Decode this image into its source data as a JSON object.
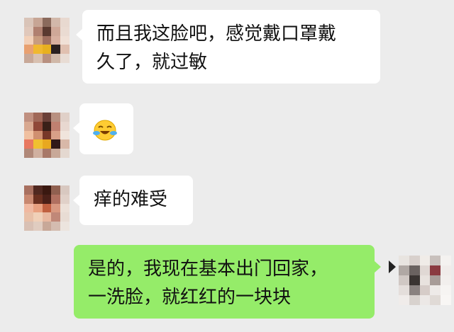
{
  "messages": [
    {
      "side": "left",
      "lines": [
        "而且我这脸吧，感觉戴口罩戴",
        "久了，就过敏"
      ]
    },
    {
      "side": "left",
      "emoji": "crying-laughing-emoji"
    },
    {
      "side": "left",
      "lines": [
        "痒的难受"
      ]
    },
    {
      "side": "right",
      "lines": [
        "是的，我现在基本出门回家，",
        "一洗脸，就红红的一块块"
      ]
    }
  ],
  "colors": {
    "background": "#ececec",
    "incoming_bubble": "#ffffff",
    "outgoing_bubble": "#95ec69"
  }
}
